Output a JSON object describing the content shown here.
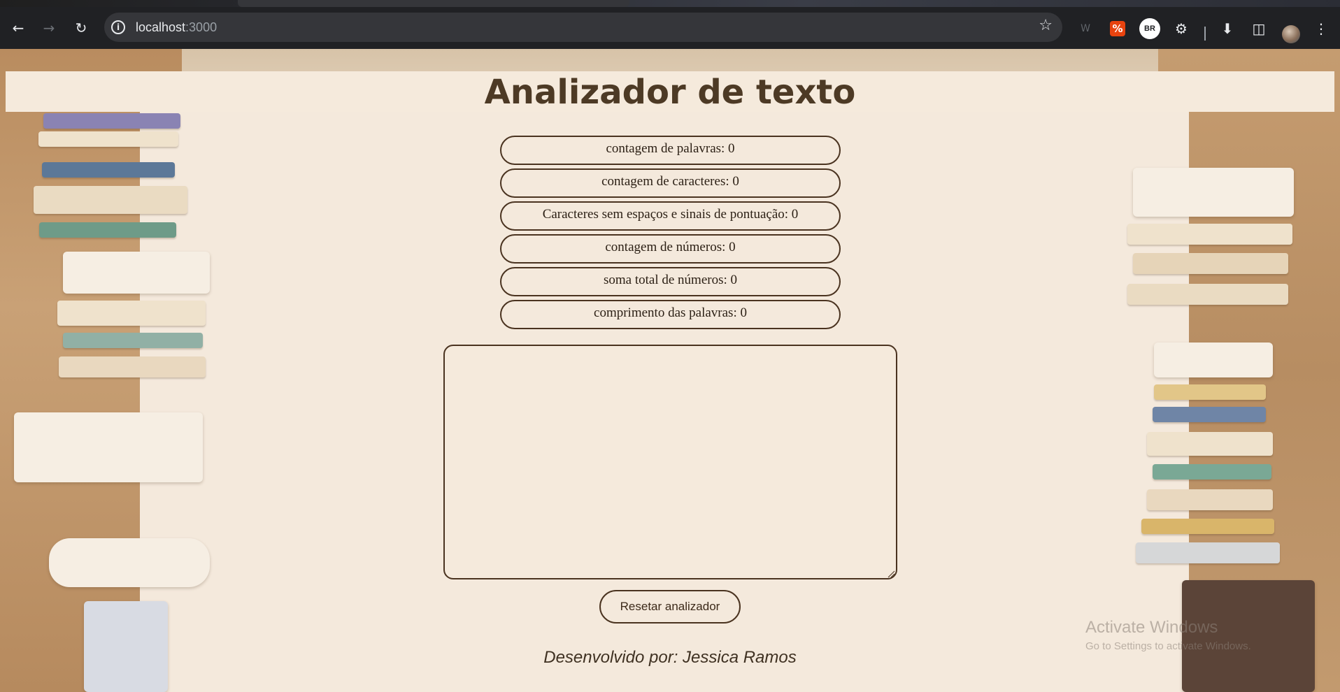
{
  "browser": {
    "url_host": "localhost",
    "url_port": ":3000",
    "extensions": [
      "w-extension-icon",
      "red-extension-icon",
      "BR",
      "puzzle-icon"
    ],
    "br_badge": "BR"
  },
  "page": {
    "title": "Analizador de texto",
    "stats": [
      "contagem de palavras: 0",
      "contagem de caracteres: 0",
      "Caracteres sem espaços e sinais de pontuação: 0",
      "contagem de números: 0",
      "soma total de números: 0",
      "comprimento das palavras: 0"
    ],
    "textarea_value": "",
    "reset_label": "Resetar analizador",
    "footer": "Desenvolvido por: Jessica Ramos"
  },
  "os_watermark": {
    "line1": "Activate Windows",
    "line2": "Go to Settings to activate Windows."
  },
  "colors": {
    "accent_border": "#4a3320",
    "page_bg": "#f4e9dc",
    "title": "#4d3a25"
  }
}
